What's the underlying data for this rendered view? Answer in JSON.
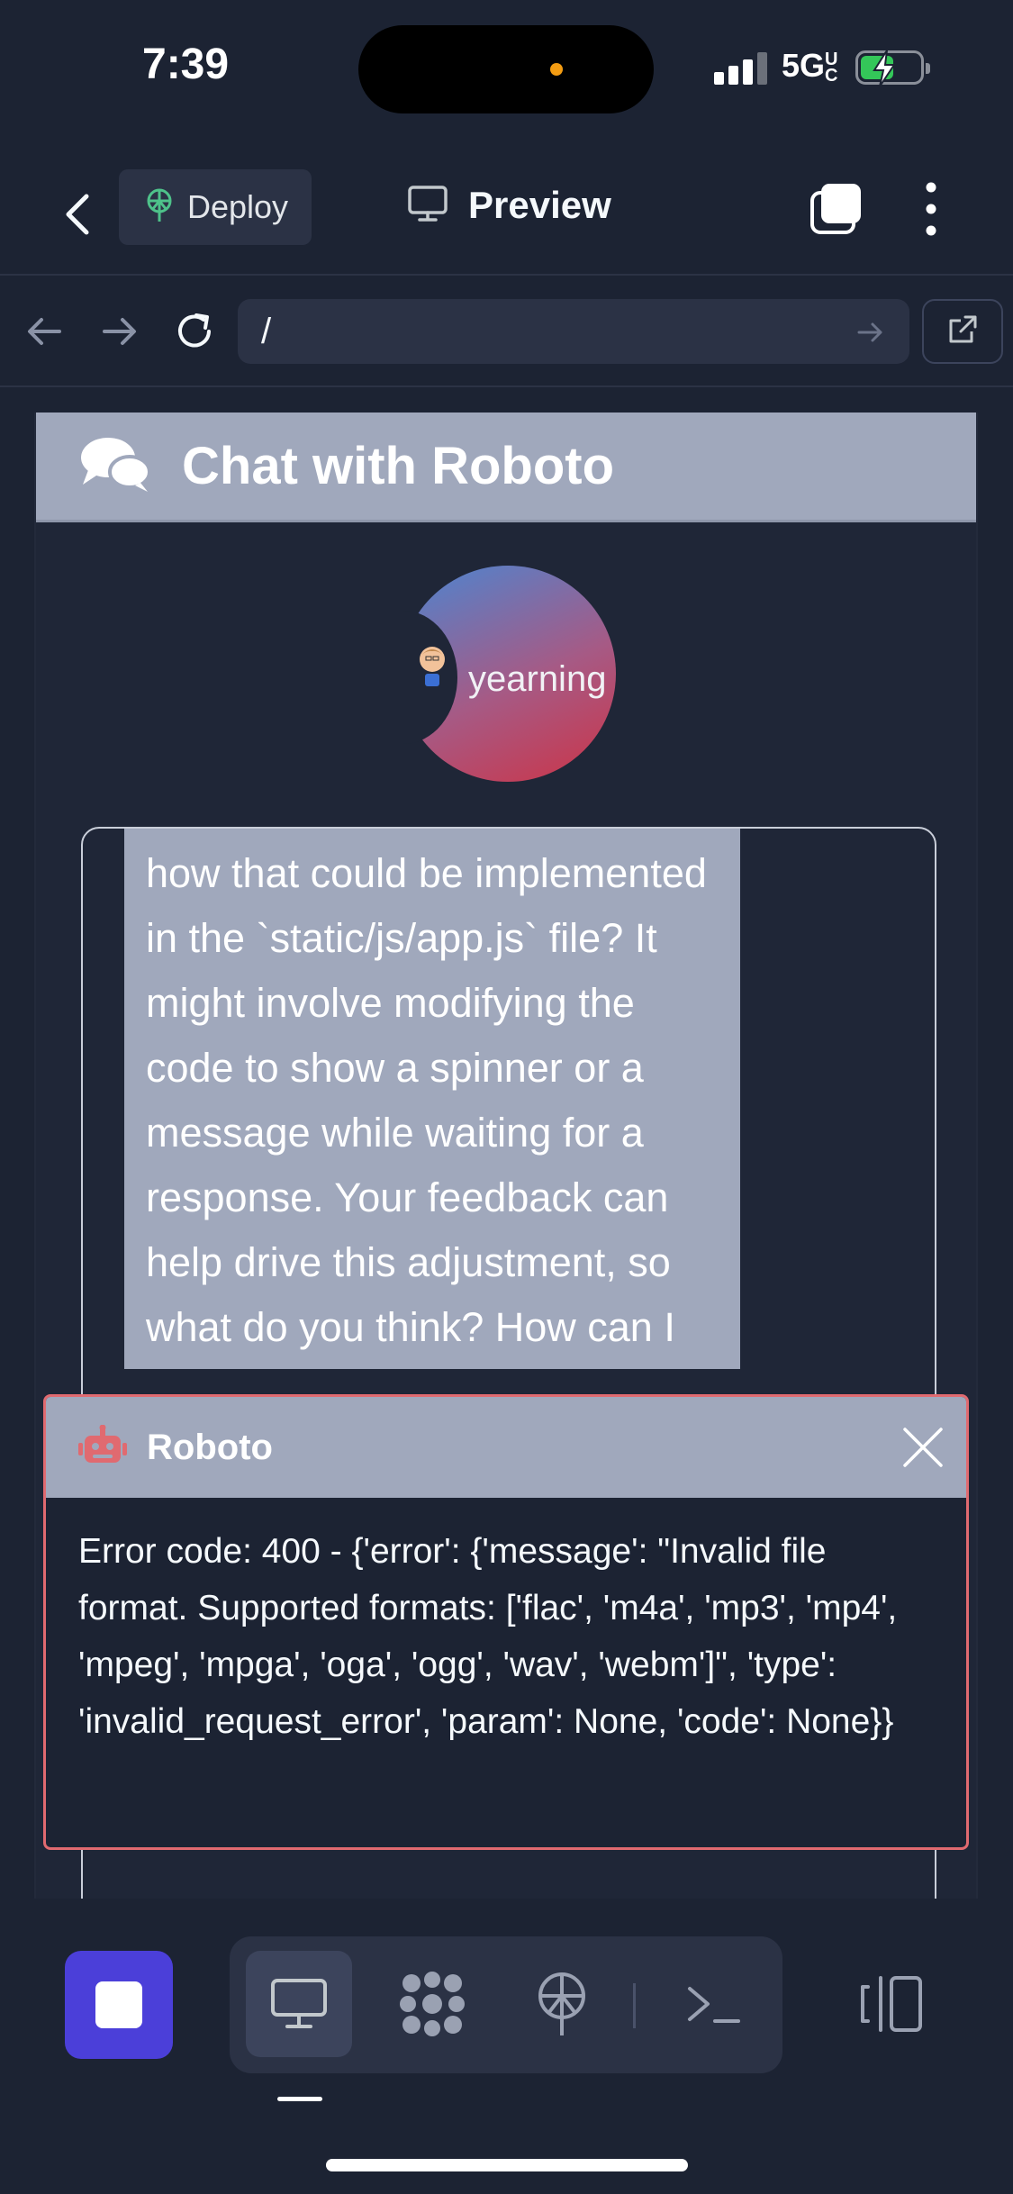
{
  "status_bar": {
    "time": "7:39",
    "network": "5G",
    "network_sub": "UC"
  },
  "toolbar": {
    "deploy_label": "Deploy",
    "preview_label": "Preview"
  },
  "url_bar": {
    "path": "/"
  },
  "chat": {
    "header_title": "Chat with Roboto",
    "avatar_label": "yearning",
    "message_text": "how that could be implemented in the `static/js/app.js` file? It might involve modifying the code to show a spinner or a message while waiting for a response. Your feedback can help drive this adjustment, so what do you think? How can I"
  },
  "toast": {
    "title": "Roboto",
    "message": "Error code: 400 - {'error': {'message': \"Invalid file format. Supported formats: ['flac', 'm4a', 'mp3', 'mp4', 'mpeg', 'mpga', 'oga', 'ogg', 'wav', 'webm']\", 'type': 'invalid_request_error', 'param': None, 'code': None}}",
    "accent_color": "#e06a70"
  },
  "bottom_bar": {
    "tools": [
      "desktop-icon",
      "apps-icon",
      "deploy-icon",
      "terminal-icon"
    ],
    "active_tool": "desktop-icon",
    "stop_color": "#4b3fd9"
  }
}
